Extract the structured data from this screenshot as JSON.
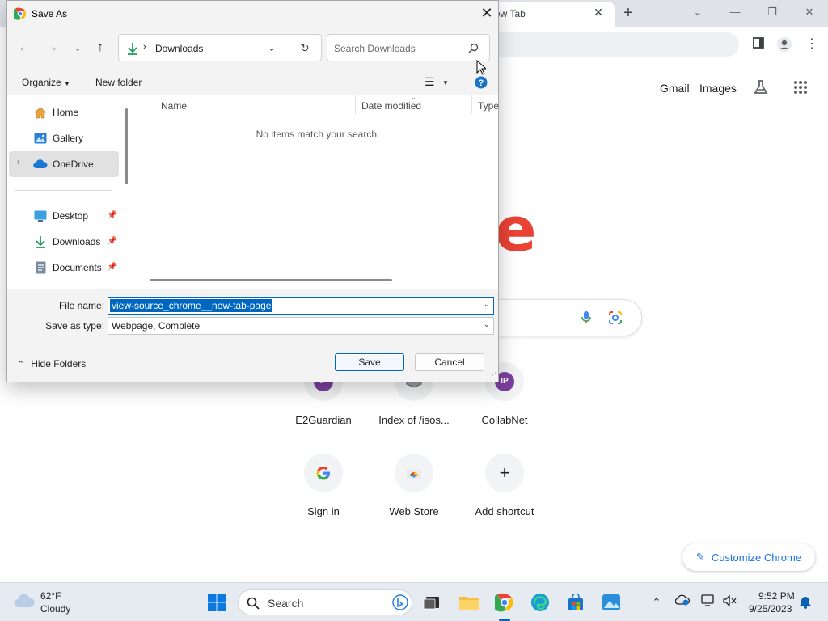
{
  "browser": {
    "tab_title": "ew Tab",
    "header_links": [
      "Gmail",
      "Images"
    ],
    "shortcuts": [
      {
        "label": "E2Guardian",
        "icon": "IP"
      },
      {
        "label": "Index of /isos...",
        "icon": "box-icon"
      },
      {
        "label": "CollabNet",
        "icon": "IP"
      },
      {
        "label": "Sign in",
        "icon": "google-icon"
      },
      {
        "label": "Web Store",
        "icon": "webstore-icon"
      },
      {
        "label": "Add shortcut",
        "icon": "plus-icon"
      }
    ],
    "customize_label": "Customize Chrome"
  },
  "dialog": {
    "title": "Save As",
    "address": {
      "location": "Downloads"
    },
    "search_placeholder": "Search Downloads",
    "commands": {
      "organize": "Organize",
      "new_folder": "New folder"
    },
    "nav_items": [
      {
        "label": "Home",
        "icon": "home-icon",
        "pinned": false
      },
      {
        "label": "Gallery",
        "icon": "gallery-icon",
        "pinned": false
      },
      {
        "label": "OneDrive",
        "icon": "onedrive-icon",
        "pinned": false,
        "selected": true
      },
      {
        "label": "Desktop",
        "icon": "desktop-icon",
        "pinned": true
      },
      {
        "label": "Downloads",
        "icon": "downloads-icon",
        "pinned": true
      },
      {
        "label": "Documents",
        "icon": "documents-icon",
        "pinned": true
      }
    ],
    "columns": [
      "Name",
      "Date modified",
      "Type"
    ],
    "empty_message": "No items match your search.",
    "file_name_label": "File name:",
    "file_name_value": "view-source_chrome__new-tab-page",
    "save_type_label": "Save as type:",
    "save_type_value": "Webpage, Complete",
    "hide_folders_label": "Hide Folders",
    "save_label": "Save",
    "cancel_label": "Cancel"
  },
  "taskbar": {
    "weather_temp": "62°F",
    "weather_desc": "Cloudy",
    "search_label": "Search",
    "time": "9:52 PM",
    "date": "9/25/2023"
  },
  "colors": {
    "accent": "#0067c0",
    "chrome_red": "#ea4335",
    "dialog_bg": "#f3f3f3"
  }
}
